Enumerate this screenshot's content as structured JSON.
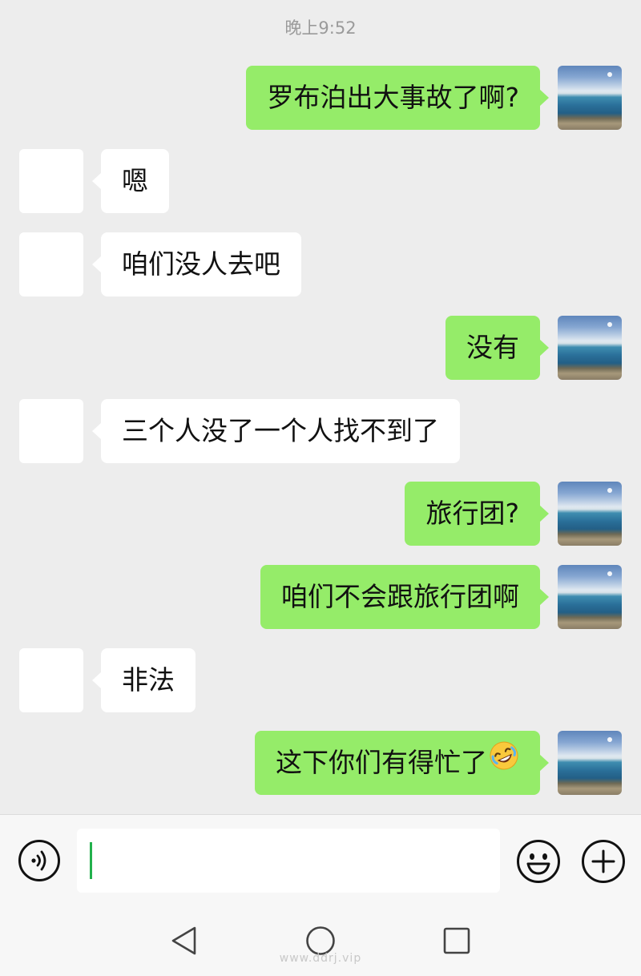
{
  "timestamp": "晚上9:52",
  "messages": [
    {
      "side": "right",
      "text": "罗布泊出大事故了啊?"
    },
    {
      "side": "left",
      "text": "嗯"
    },
    {
      "side": "left",
      "text": "咱们没人去吧"
    },
    {
      "side": "right",
      "text": "没有"
    },
    {
      "side": "left",
      "text": "三个人没了一个人找不到了"
    },
    {
      "side": "right",
      "text": "旅行团?"
    },
    {
      "side": "right",
      "text": "咱们不会跟旅行团啊"
    },
    {
      "side": "left",
      "text": "非法"
    },
    {
      "side": "right",
      "text": "这下你们有得忙了",
      "emoji": "rolling-on-floor-laughing-emoji"
    }
  ],
  "input_bar": {
    "voice_icon": "voice-icon",
    "text_value": "",
    "emoji_icon": "smiley-icon",
    "plus_icon": "plus-circle-icon"
  },
  "nav": {
    "back_icon": "back-triangle-icon",
    "home_icon": "home-circle-icon",
    "recent_icon": "recent-square-icon"
  },
  "watermark": "www.ddrj.vip",
  "colors": {
    "background": "#ededed",
    "sent_bubble": "#95ec69",
    "received_bubble": "#ffffff",
    "caret": "#22b14c"
  }
}
